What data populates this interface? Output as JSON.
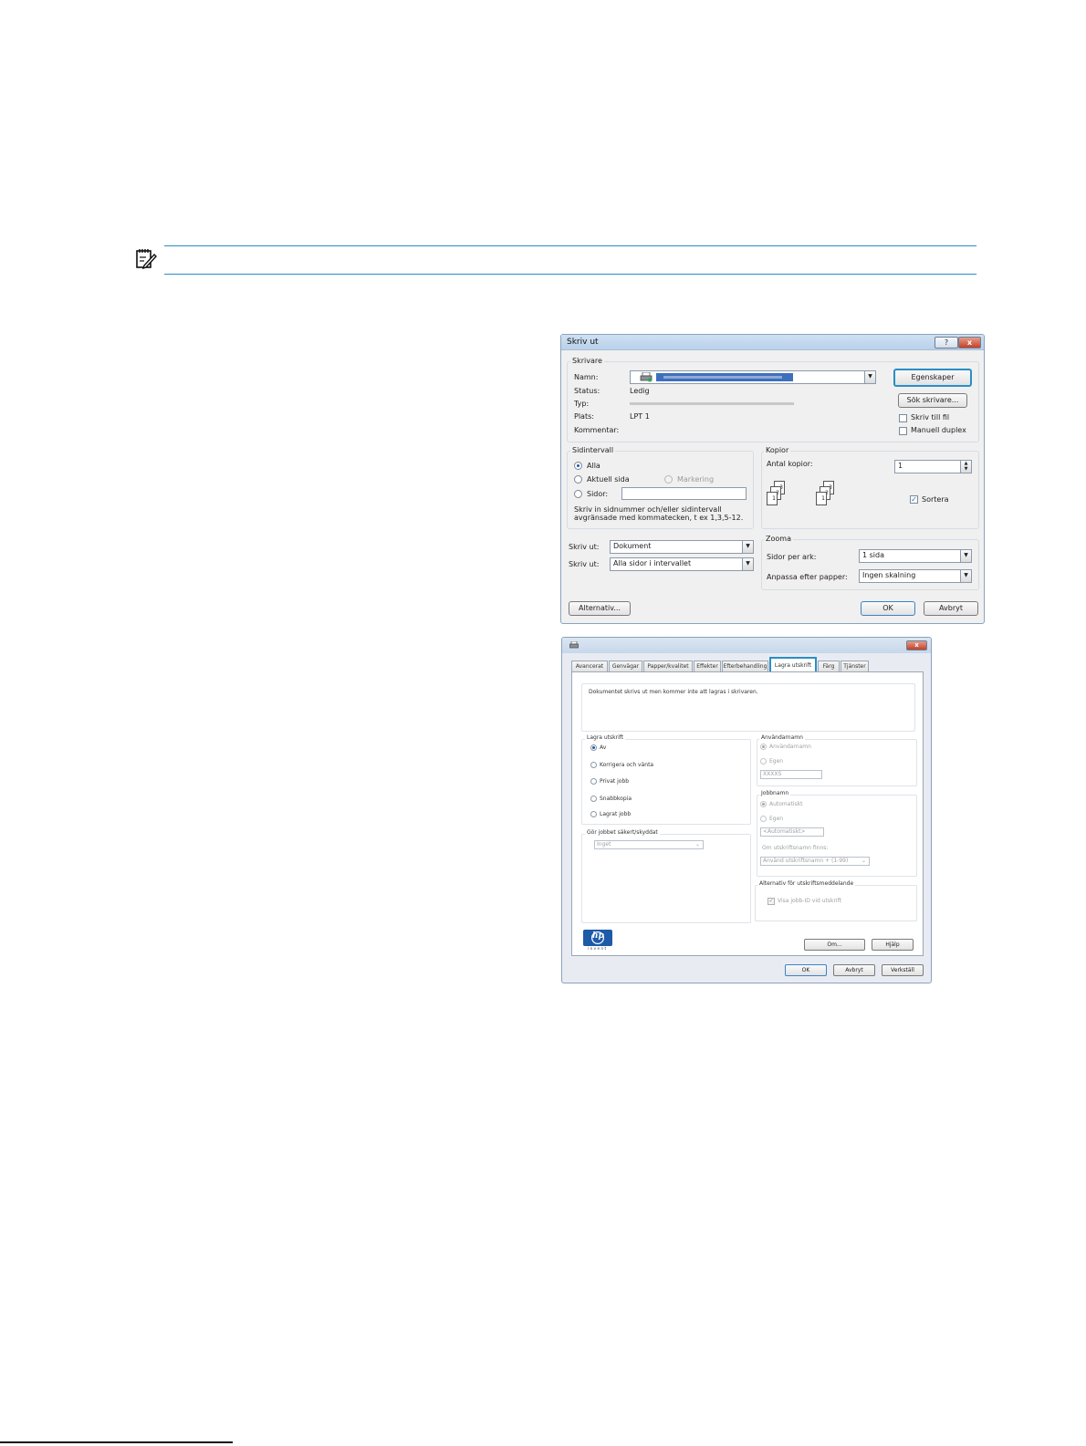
{
  "print_dialog": {
    "title": "Skriv ut",
    "help_button": "?",
    "close_button": "x",
    "printer_group": {
      "label": "Skrivare",
      "name_label": "Namn:",
      "status_label": "Status:",
      "status_value": "Ledig",
      "type_label": "Typ:",
      "location_label": "Plats:",
      "location_value": "LPT 1",
      "comment_label": "Kommentar:",
      "properties_button": "Egenskaper",
      "find_printer_button": "Sök skrivare...",
      "print_to_file": "Skriv till fil",
      "manual_duplex": "Manuell duplex"
    },
    "page_range": {
      "label": "Sidintervall",
      "all": "Alla",
      "current_page": "Aktuell sida",
      "selection": "Markering",
      "pages": "Sidor:",
      "hint_line1": "Skriv in sidnummer och/eller sidintervall",
      "hint_line2": "avgränsade med kommatecken, t ex 1,3,5-12."
    },
    "copies": {
      "label": "Kopior",
      "count_label": "Antal kopior:",
      "count_value": "1",
      "collate": "Sortera"
    },
    "print_what_label": "Skriv ut:",
    "print_what_value": "Dokument",
    "print_label": "Skriv ut:",
    "print_value": "Alla sidor i intervallet",
    "zoom": {
      "label": "Zooma",
      "pages_per_sheet_label": "Sidor per ark:",
      "pages_per_sheet_value": "1 sida",
      "scale_label": "Anpassa efter papper:",
      "scale_value": "Ingen skalning"
    },
    "options_button": "Alternativ...",
    "ok_button": "OK",
    "cancel_button": "Avbryt"
  },
  "properties_dialog": {
    "close_button": "x",
    "tabs": [
      "Avancerat",
      "Genvägar",
      "Papper/kvalitet",
      "Effekter",
      "Efterbehandling",
      "Lagra utskrift",
      "Färg",
      "Tjänster"
    ],
    "info_text": "Dokumentet skrivs ut men kommer inte att lagras i skrivaren.",
    "job_storage": {
      "label": "Lagra utskrift",
      "off": "Av",
      "proof_hold": "Korrigera och vänta",
      "private_job": "Privat jobb",
      "quick_copy": "Snabbkopia",
      "stored_job": "Lagrat jobb"
    },
    "secure_job": {
      "label": "Gör jobbet säkert/skyddat",
      "value": "Inget"
    },
    "user_name": {
      "label": "Användarnamn",
      "user": "Användarnamn",
      "custom": "Egen",
      "value": "XXXXS"
    },
    "job_name": {
      "label": "Jobbnamn",
      "automatic": "Automatiskt",
      "custom": "Egen",
      "value": "<Automatiskt>",
      "exists_label": "Om utskriftsnamn finns:",
      "exists_value": "Använd utskriftsnamn + (1-99)"
    },
    "notification": {
      "label": "Alternativ för utskriftsmeddelande",
      "show_job_id": "Visa jobb-ID vid utskrift"
    },
    "about_button": "Om...",
    "help_button": "Hjälp",
    "ok_button": "OK",
    "cancel_button": "Avbryt",
    "apply_button": "Verkställ",
    "logo_text": "hp",
    "logo_subtext": "invent"
  }
}
